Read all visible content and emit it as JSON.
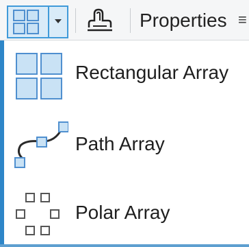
{
  "toolbar": {
    "array_button_icon": "rectangular-array-icon",
    "dropdown_icon": "chevron-down-icon",
    "associative_icon": "associative-array-icon",
    "properties_label": "Properties",
    "properties_suffix": "≡"
  },
  "menu": {
    "items": [
      {
        "label": "Rectangular Array",
        "icon": "rectangular-array-icon"
      },
      {
        "label": "Path Array",
        "icon": "path-array-icon"
      },
      {
        "label": "Polar Array",
        "icon": "polar-array-icon"
      }
    ]
  },
  "colors": {
    "accent": "#3f9ad9",
    "icon_fill": "#c9e2f5",
    "icon_stroke": "#4f8fcf",
    "grip_fill": "#ffffff",
    "grip_stroke": "#555555"
  }
}
